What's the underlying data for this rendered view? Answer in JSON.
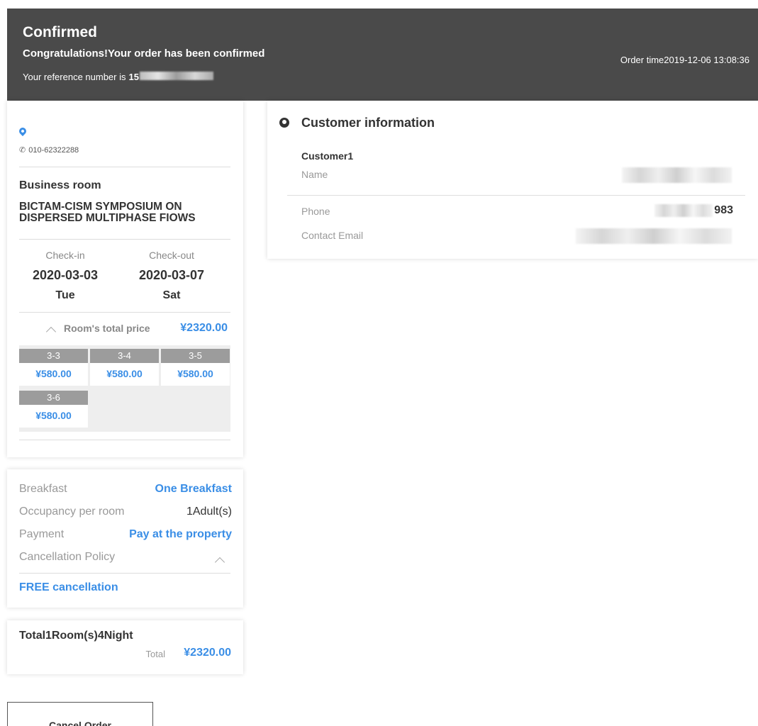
{
  "header": {
    "status": "Confirmed",
    "message": "Congratulations!Your order has been confirmed",
    "reference_label": "Your reference number is",
    "reference_prefix": "15",
    "order_time": "Order time2019-12-06 13:08:36"
  },
  "hotel": {
    "phone": "010-62322288",
    "room_type": "Business room",
    "name": "BICTAM-CISM SYMPOSIUM ON DISPERSED MULTIPHASE FIOWS"
  },
  "stay": {
    "checkin_label": "Check-in",
    "checkout_label": "Check-out",
    "checkin_date": "2020-03-03",
    "checkout_date": "2020-03-07",
    "checkin_day": "Tue",
    "checkout_day": "Sat"
  },
  "price": {
    "toggle_label": "Room's total price",
    "total": "¥2320.00",
    "nights": [
      {
        "date": "3-3",
        "price": "¥580.00"
      },
      {
        "date": "3-4",
        "price": "¥580.00"
      },
      {
        "date": "3-5",
        "price": "¥580.00"
      },
      {
        "date": "3-6",
        "price": "¥580.00"
      }
    ]
  },
  "policy": {
    "breakfast_label": "Breakfast",
    "breakfast_value": "One Breakfast",
    "occupancy_label": "Occupancy per room",
    "occupancy_value": "1Adult(s)",
    "payment_label": "Payment",
    "payment_value": "Pay at the property",
    "cancellation_label": "Cancellation Policy",
    "cancellation_value": "FREE cancellation"
  },
  "summary": {
    "title": "Total1Room(s)4Night",
    "total_label": "Total",
    "total_value": "¥2320.00"
  },
  "actions": {
    "cancel_label": "Cancel Order"
  },
  "customer": {
    "section_title": "Customer information",
    "customer_name": "Customer1",
    "name_label": "Name",
    "phone_label": "Phone",
    "phone_suffix": "983",
    "email_label": "Contact Email"
  },
  "colors": {
    "accent": "#3a8ee6",
    "header_bg": "#4a4a4a",
    "night_header": "#9c9c9c"
  },
  "icons": [
    "location-pin-icon",
    "phone-icon",
    "chevron-up-icon",
    "user-icon"
  ]
}
